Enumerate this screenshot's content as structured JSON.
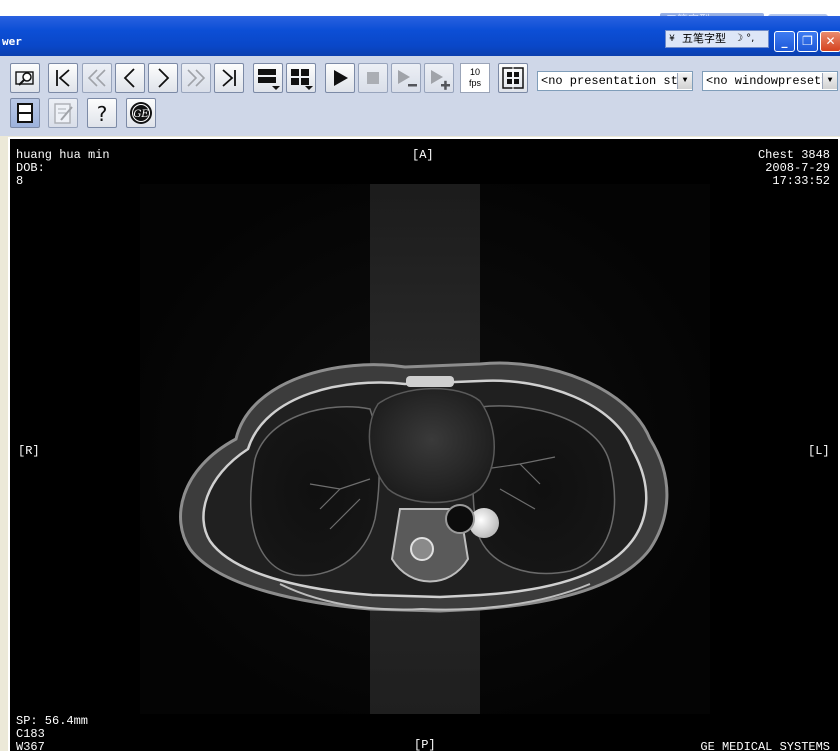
{
  "ime_top": {
    "label": "五笔字型"
  },
  "window": {
    "title": "wer"
  },
  "ime_bar": {
    "toggle": "¥",
    "name": "五笔字型",
    "moon": "☽ °,",
    "mode": "五笔字型"
  },
  "window_buttons": {
    "minimize": "_",
    "maximize": "❐",
    "close": "✕"
  },
  "toolbar": {
    "fps_value": "10",
    "fps_unit": "fps",
    "presentation_select": "<no presentation st:",
    "windowpreset_select": "<no windowpreset>",
    "icons": [
      "magnify-icon",
      "first-image-icon",
      "fast-back-icon",
      "previous-icon",
      "next-icon",
      "fast-forward-icon",
      "last-image-icon",
      "layout-menu-icon",
      "grid-menu-icon",
      "play-icon",
      "stop-icon",
      "slower-icon",
      "faster-icon",
      "settings-icon",
      "film-icon",
      "report-icon",
      "help-icon",
      "ge-logo-icon"
    ]
  },
  "viewer": {
    "patient_name": "huang hua min",
    "dob": "DOB:",
    "image_number": "8",
    "orientation_top": "[A]",
    "orientation_bottom": "[P]",
    "orientation_left": "[R]",
    "orientation_right": "[L]",
    "study": "Chest 3848",
    "date": "2008-7-29",
    "time": "17:33:52",
    "slice_position": "SP: 56.4mm",
    "window_center": "C183",
    "window_width": "W367",
    "manufacturer": "GE MEDICAL SYSTEMS"
  }
}
